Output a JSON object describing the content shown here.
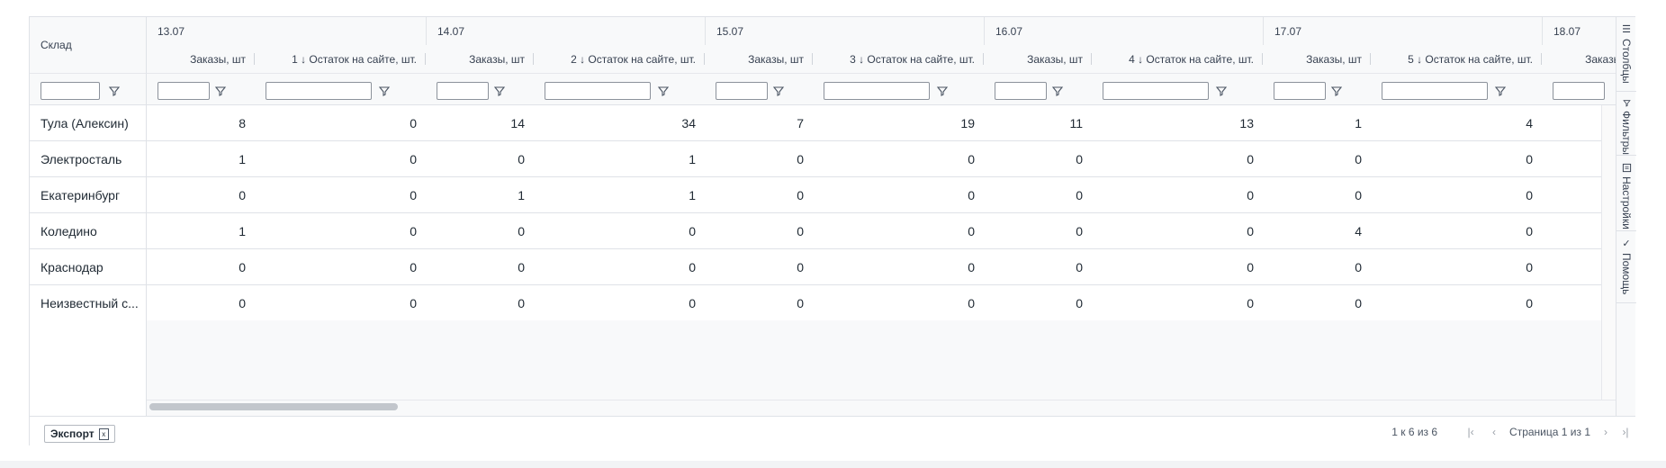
{
  "header": {
    "warehouse_label": "Склад",
    "dates": [
      "13.07",
      "14.07",
      "15.07",
      "16.07",
      "17.07",
      "18.07"
    ],
    "orders_label": "Заказы, шт",
    "stock_labels": [
      "1 ↓ Остаток на сайте, шт.",
      "2 ↓ Остаток на сайте, шт.",
      "3 ↓ Остаток на сайте, шт.",
      "4 ↓ Остаток на сайте, шт.",
      "5 ↓ Остаток на сайте, шт."
    ],
    "last_partial_label": "Заказы, шт"
  },
  "rows": [
    {
      "name": "Тула (Алексин)",
      "values": [
        "8",
        "0",
        "14",
        "34",
        "7",
        "19",
        "11",
        "13",
        "1",
        "4"
      ]
    },
    {
      "name": "Электросталь",
      "values": [
        "1",
        "0",
        "0",
        "1",
        "0",
        "0",
        "0",
        "0",
        "0",
        "0"
      ]
    },
    {
      "name": "Екатеринбург",
      "values": [
        "0",
        "0",
        "1",
        "1",
        "0",
        "0",
        "0",
        "0",
        "0",
        "0"
      ]
    },
    {
      "name": "Коледино",
      "values": [
        "1",
        "0",
        "0",
        "0",
        "0",
        "0",
        "0",
        "0",
        "4",
        "0"
      ]
    },
    {
      "name": "Краснодар",
      "values": [
        "0",
        "0",
        "0",
        "0",
        "0",
        "0",
        "0",
        "0",
        "0",
        "0"
      ]
    },
    {
      "name": "Неизвестный с...",
      "values": [
        "0",
        "0",
        "0",
        "0",
        "0",
        "0",
        "0",
        "0",
        "0",
        "0"
      ]
    }
  ],
  "sidebar": {
    "columns": "Столбцы",
    "filters": "Фильтры",
    "settings": "Настройки",
    "help": "Помощь"
  },
  "footer": {
    "export_label": "Экспорт",
    "excel_glyph": "x",
    "summary": "1 к 6 из 6",
    "page_text": "Страница 1 из 1"
  },
  "icons": {
    "filter": "filter-icon",
    "columns": "columns-icon",
    "settings": "settings-icon",
    "help": "check-icon",
    "first": "first-page-icon",
    "prev": "prev-page-icon",
    "next": "next-page-icon",
    "last": "last-page-icon"
  },
  "colors": {
    "border": "#dfe2e7",
    "header_bg": "#f8f9fa",
    "text": "#1f2933"
  }
}
